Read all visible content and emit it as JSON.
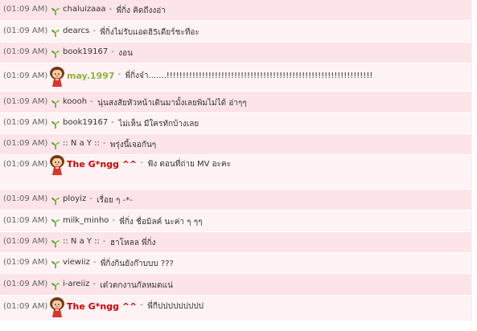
{
  "chat": {
    "messages": [
      {
        "time": "(01:09 AM)",
        "icon": "sprout-icon",
        "user": "chaluizaaa",
        "user_color": "#333333",
        "sep": "-",
        "text": "พี่กิ่ง คิดถึงงอ่า"
      },
      {
        "time": "(01:09 AM)",
        "icon": "sprout-icon",
        "user": "dearcs",
        "user_color": "#333333",
        "sep": "-",
        "text": "พี่กิ่งไม่รับแอดฮิ5เดียร์ชะทีอะ"
      },
      {
        "time": "(01:09 AM)",
        "icon": "sprout-icon",
        "user": "book19167",
        "user_color": "#333333",
        "sep": "-",
        "text": "งอน"
      },
      {
        "time": "(01:09 AM)",
        "icon": "girl-avatar-icon",
        "user": "may.1997",
        "user_color": "#8db43c",
        "sep": "-",
        "text": "พี่กิ่งจ๋า.......!!!!!!!!!!!!!!!!!!!!!!!!!!!!!!!!!!!!!!!!!!!!!!!!!!!!!!!!!!!!!!!!"
      },
      {
        "time": "(01:09 AM)",
        "icon": "sprout-icon",
        "user": "koooh",
        "user_color": "#333333",
        "sep": "-",
        "text": "นุ่นสงสัยหัวหน้าเดินมามั้งเลยพิมไม่ได้ อ่าๆๆ"
      },
      {
        "time": "(01:09 AM)",
        "icon": "sprout-icon",
        "user": "book19167",
        "user_color": "#333333",
        "sep": "-",
        "text": "ไม่เห็น มีใครทักบ้างเลย"
      },
      {
        "time": "(01:09 AM)",
        "icon": "sprout-icon",
        "user": ":: N a Y ::",
        "user_color": "#333333",
        "sep": "-",
        "text": "พรุ่งนี้เจอกันๆ"
      },
      {
        "time": "(01:09 AM)",
        "icon": "girl-avatar-icon",
        "user": "The G*ngg ^^",
        "user_color": "#cc0000",
        "sep": "-",
        "text": "ฟัง ตอนที่ถ่าย MV อะคะ"
      },
      {
        "time": "(01:09 AM)",
        "icon": "sprout-icon",
        "user": "ployiz",
        "user_color": "#333333",
        "sep": "-",
        "text": "เรื่อย ๆ -*-"
      },
      {
        "time": "(01:09 AM)",
        "icon": "sprout-icon",
        "user": "milk_minho",
        "user_color": "#333333",
        "sep": "-",
        "text": "พี่กิ่ง ชื่อมิลค์ นะค่า ๆ ๆๆ"
      },
      {
        "time": "(01:09 AM)",
        "icon": "sprout-icon",
        "user": ":: N a Y ::",
        "user_color": "#333333",
        "sep": "-",
        "text": "ฮาโหลล พี่กิ่ง"
      },
      {
        "time": "(01:09 AM)",
        "icon": "sprout-icon",
        "user": "viewiiz",
        "user_color": "#333333",
        "sep": "-",
        "text": "พี่กิ่งกินยังก๊าบบบ ???"
      },
      {
        "time": "(01:09 AM)",
        "icon": "sprout-icon",
        "user": "i-areiiz",
        "user_color": "#333333",
        "sep": "-",
        "text": "เด๋วตกงานกัลหมดแน่"
      },
      {
        "time": "(01:09 AM)",
        "icon": "girl-avatar-icon",
        "user": "The G*ngg ^^",
        "user_color": "#cc0000",
        "sep": "-",
        "text": "พี่กีปปปปปปปปป"
      }
    ]
  }
}
